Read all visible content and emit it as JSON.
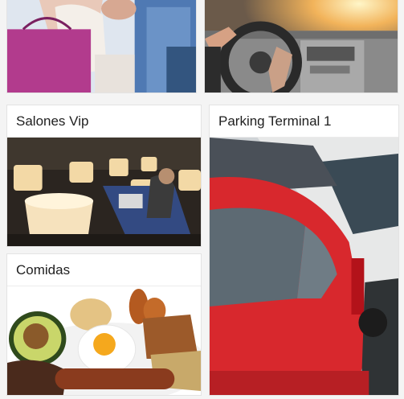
{
  "cards": [
    {
      "id": "shopping",
      "title": "",
      "image_icon": "shopping-bags-photo"
    },
    {
      "id": "driving",
      "title": "",
      "image_icon": "car-steering-wheel-photo"
    },
    {
      "id": "vip",
      "title": "Salones Vip",
      "image_icon": "vip-lounge-photo"
    },
    {
      "id": "parking",
      "title": "Parking Terminal 1",
      "image_icon": "parked-cars-photo"
    },
    {
      "id": "food",
      "title": "Comidas",
      "image_icon": "food-plate-photo"
    }
  ],
  "colors": {
    "background": "#f4f4f4",
    "card": "#ffffff",
    "title_text": "#1f1f1f"
  }
}
